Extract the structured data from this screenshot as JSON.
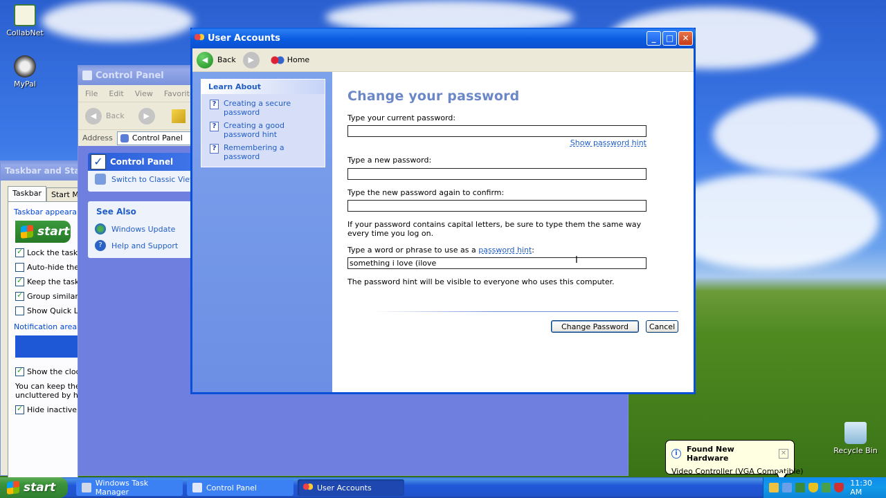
{
  "desktop": {
    "icons": [
      {
        "label": "CollabNet"
      },
      {
        "label": "MyPal"
      },
      {
        "label": "Recycle Bin"
      }
    ]
  },
  "taskbar_properties": {
    "title": "Taskbar and Start Menu Properties",
    "tabs": [
      "Taskbar",
      "Start Menu"
    ],
    "group_appearance": "Taskbar appearance",
    "start_label": "start",
    "options": [
      {
        "label": "Lock the taskbar",
        "checked": true
      },
      {
        "label": "Auto-hide the taskbar",
        "checked": false
      },
      {
        "label": "Keep the taskbar on top",
        "checked": true
      },
      {
        "label": "Group similar taskbar buttons",
        "checked": true
      },
      {
        "label": "Show Quick Launch",
        "checked": false
      }
    ],
    "group_notification": "Notification area",
    "show_clock": {
      "label": "Show the clock",
      "checked": true
    },
    "note": "You can keep the notification area uncluttered by hiding icons that you have not clicked recently.",
    "hide_inactive": {
      "label": "Hide inactive icons",
      "checked": true
    }
  },
  "control_panel": {
    "title": "Control Panel",
    "menu": [
      "File",
      "Edit",
      "View",
      "Favorites"
    ],
    "back_label": "Back",
    "address_label": "Address",
    "address_value": "Control Panel",
    "panel_title": "Control Panel",
    "switch_view": "Switch to Classic View",
    "see_also": "See Also",
    "see_also_items": [
      "Windows Update",
      "Help and Support"
    ]
  },
  "user_accounts": {
    "title": "User Accounts",
    "nav": {
      "back": "Back",
      "home": "Home"
    },
    "learn_about": {
      "header": "Learn About",
      "links": [
        "Creating a secure password",
        "Creating a good password hint",
        "Remembering a password"
      ]
    },
    "heading": "Change your password",
    "current_label": "Type your current password:",
    "show_hint": "Show password hint",
    "new_label": "Type a new password:",
    "confirm_label": "Type the new password again to confirm:",
    "caps_note": "If your password contains capital letters, be sure to type them the same way every time you log on.",
    "hint_label_prefix": "Type a word or phrase to use as a",
    "hint_link": "password hint",
    "hint_value": "something i love (ilove",
    "hint_note": "The password hint will be visible to everyone who uses this computer.",
    "change_button": "Change Password",
    "cancel_button": "Cancel"
  },
  "taskbar": {
    "start": "start",
    "tasks": [
      "Windows Task Manager",
      "Control Panel",
      "User Accounts"
    ],
    "clock": "11:30 AM"
  },
  "balloon": {
    "title": "Found New Hardware",
    "body": "Video Controller (VGA Compatible)"
  },
  "colors": {
    "xp_blue": "#0a58e0",
    "link_blue": "#215dc6",
    "heading_blue": "#6b87c7",
    "start_green": "#3c943c"
  }
}
